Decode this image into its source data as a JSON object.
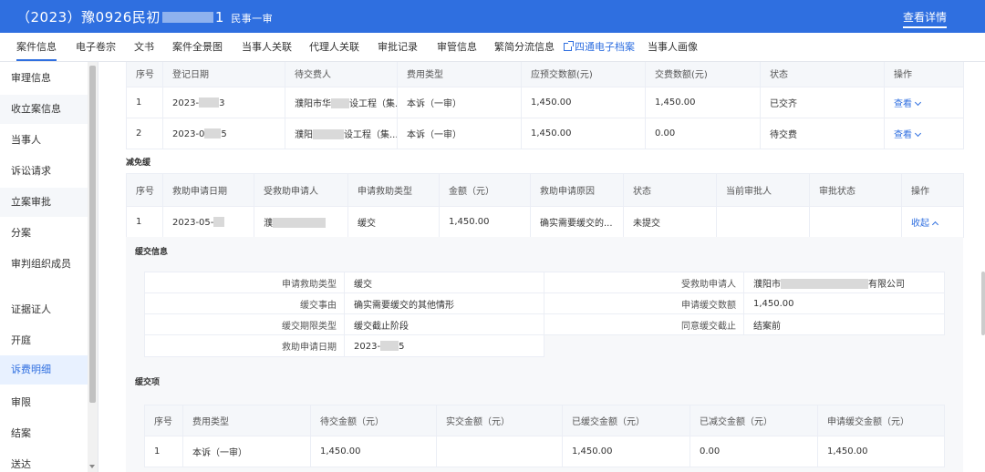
{
  "header": {
    "case_prefix": "（2023）豫0926民初",
    "case_suffix": "1",
    "procedure": "民事一审",
    "detail_link": "查看详情"
  },
  "tabs": [
    {
      "label": "案件信息",
      "active": true
    },
    {
      "label": "电子卷宗"
    },
    {
      "label": "文书"
    },
    {
      "label": "案件全景图"
    },
    {
      "label": "当事人关联"
    },
    {
      "label": "代理人关联"
    },
    {
      "label": "审批记录"
    },
    {
      "label": "审管信息"
    },
    {
      "label": "繁简分流信息"
    },
    {
      "label": "四通电子档案",
      "link": true
    },
    {
      "label": "当事人画像"
    }
  ],
  "sidebar": {
    "items": [
      {
        "label": "审理信息"
      },
      {
        "label": "收立案信息"
      },
      {
        "label": "当事人"
      },
      {
        "label": "诉讼请求"
      },
      {
        "label": "立案审批"
      },
      {
        "label": "分案"
      },
      {
        "label": "审判组织成员"
      },
      {
        "label": "证据证人"
      },
      {
        "label": "开庭"
      },
      {
        "label": "诉费明细",
        "active": true
      },
      {
        "label": "审限"
      },
      {
        "label": "结案"
      },
      {
        "label": "送达"
      }
    ]
  },
  "fee_table": {
    "headers": [
      "序号",
      "登记日期",
      "待交费人",
      "费用类型",
      "应预交数额(元)",
      "交费数额(元)",
      "状态",
      "操作"
    ],
    "rows": [
      {
        "idx": "1",
        "date": "2023-",
        "date_end": "3",
        "payer_a": "濮阳市华",
        "payer_b": "设工程（集...",
        "type": "本诉（一审）",
        "due": "1,450.00",
        "paid": "1,450.00",
        "status": "已交齐",
        "action": "查看"
      },
      {
        "idx": "2",
        "date": "2023-0",
        "date_end": "5",
        "payer_a": "濮阳",
        "payer_b": "设工程（集...",
        "type": "本诉（一审）",
        "due": "1,450.00",
        "paid": "0.00",
        "status": "待交费",
        "action": "查看"
      }
    ]
  },
  "relief": {
    "section_title": "减免缓",
    "headers": [
      "序号",
      "救助申请日期",
      "受救助申请人",
      "申请救助类型",
      "金额（元）",
      "救助申请原因",
      "状态",
      "当前审批人",
      "审批状态",
      "操作"
    ],
    "rows": [
      {
        "idx": "1",
        "date": "2023-05-",
        "applicant": "濮",
        "type": "缓交",
        "amount": "1,450.00",
        "reason": "确实需要缓交的...",
        "status": "未提交",
        "approver": "",
        "approval_status": "",
        "action": "收起"
      }
    ]
  },
  "deferral_info": {
    "section_title": "缓交信息",
    "left": [
      {
        "label": "申请救助类型",
        "value": "缓交"
      },
      {
        "label": "缓交事由",
        "value": "确实需要缓交的其他情形"
      },
      {
        "label": "缓交期限类型",
        "value": "缓交截止阶段"
      },
      {
        "label": "救助申请日期",
        "value": "2023-",
        "value_end": "5"
      }
    ],
    "right": [
      {
        "label": "受救助申请人",
        "value": "濮阳市",
        "value_end": "有限公司"
      },
      {
        "label": "申请缓交数额",
        "value": "1,450.00"
      },
      {
        "label": "同意缓交截止",
        "value": "结案前"
      }
    ]
  },
  "deferral_items": {
    "section_title": "缓交项",
    "headers": [
      "序号",
      "费用类型",
      "待交金额（元）",
      "实交金额（元）",
      "已缓交金额（元）",
      "已减交金额（元）",
      "申请缓交金额（元）"
    ],
    "rows": [
      {
        "idx": "1",
        "type": "本诉（一审）",
        "pending": "1,450.00",
        "actual": "",
        "deferred": "1,450.00",
        "reduced": "0.00",
        "apply": "1,450.00"
      }
    ]
  }
}
